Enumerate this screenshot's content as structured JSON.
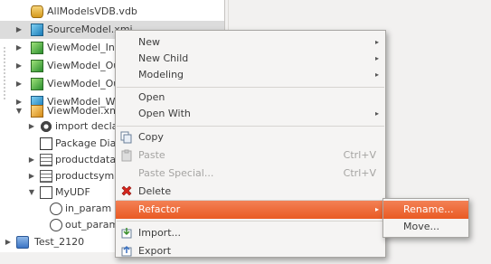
{
  "tree": {
    "items": [
      {
        "label": "AllModelsVDB.vdb",
        "icon": "vdb-cylinder-icon",
        "arrow": ""
      },
      {
        "label": "SourceModel.xmi",
        "icon": "source-model-icon",
        "arrow": "▶"
      },
      {
        "label": "ViewModel_Inpu",
        "icon": "view-model-icon",
        "arrow": "▶"
      },
      {
        "label": "ViewModel_Out",
        "icon": "view-model-icon",
        "arrow": "▶"
      },
      {
        "label": "ViewModel_Out",
        "icon": "view-model-icon",
        "arrow": "▶"
      },
      {
        "label": "ViewModel_WS.",
        "icon": "view-model-ws-icon",
        "arrow": "▶"
      },
      {
        "label": "ViewModel.xmi",
        "icon": "view-model-icon",
        "arrow": "▼"
      },
      {
        "label": "import declara",
        "icon": "import-gear-icon",
        "arrow": "▶"
      },
      {
        "label": "Package Diagra",
        "icon": "package-diagram-icon",
        "arrow": ""
      },
      {
        "label": "productdata",
        "icon": "table-icon",
        "arrow": "▶"
      },
      {
        "label": "productsymbo",
        "icon": "table-icon",
        "arrow": "▶"
      },
      {
        "label": "MyUDF",
        "icon": "udf-icon",
        "arrow": "▼"
      },
      {
        "label": "in_param : s",
        "icon": "parameter-icon",
        "arrow": ""
      },
      {
        "label": "out_param :",
        "icon": "parameter-icon",
        "arrow": ""
      },
      {
        "label": "Test_2120",
        "icon": "project-icon",
        "arrow": "▶"
      }
    ]
  },
  "context_menu": {
    "items": [
      {
        "label": "New",
        "submenu": true
      },
      {
        "label": "New Child",
        "submenu": true
      },
      {
        "label": "Modeling",
        "submenu": true
      },
      {
        "label": "Open",
        "submenu": false
      },
      {
        "label": "Open With",
        "submenu": true
      },
      {
        "label": "Copy",
        "icon": "copy-icon"
      },
      {
        "label": "Paste",
        "icon": "paste-icon",
        "shortcut": "Ctrl+V",
        "disabled": true
      },
      {
        "label": "Paste Special...",
        "shortcut": "Ctrl+V",
        "disabled": true
      },
      {
        "label": "Delete",
        "icon": "delete-icon"
      },
      {
        "label": "Refactor",
        "submenu": true,
        "highlighted": true
      },
      {
        "label": "Import...",
        "icon": "import-icon"
      },
      {
        "label": "Export",
        "icon": "export-icon"
      }
    ],
    "submenu_arrow": "▸"
  },
  "refactor_submenu": {
    "items": [
      {
        "label": "Rename...",
        "highlighted": true
      },
      {
        "label": "Move..."
      }
    ]
  },
  "colors": {
    "highlight": "#e95a23",
    "menu_bg": "#f5f4f3"
  }
}
